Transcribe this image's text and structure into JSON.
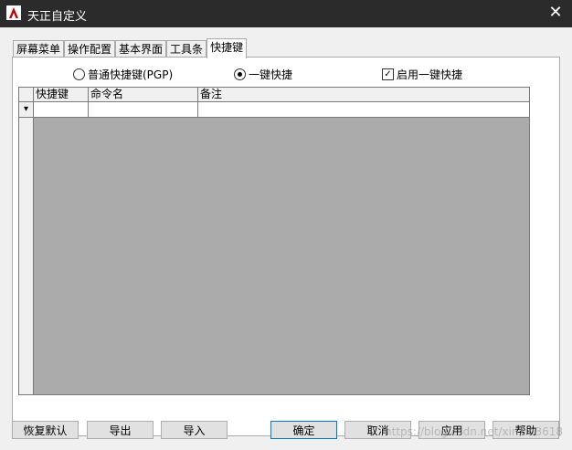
{
  "window": {
    "title": "天正自定义",
    "close_glyph": "✕"
  },
  "tabs": [
    {
      "label": "屏幕菜单"
    },
    {
      "label": "操作配置"
    },
    {
      "label": "基本界面"
    },
    {
      "label": "工具条"
    },
    {
      "label": "快捷键",
      "active": true
    }
  ],
  "options": {
    "normal_shortcut": {
      "label": "普通快捷键(PGP)",
      "selected": false
    },
    "one_key": {
      "label": "一键快捷",
      "selected": true
    },
    "enable_one_key": {
      "label": "启用一键快捷",
      "checked": true
    }
  },
  "grid": {
    "columns": [
      "快捷键",
      "命令名",
      "备注"
    ],
    "new_row_marker": "▾"
  },
  "buttons": {
    "restore_default": "恢复默认",
    "export": "导出",
    "import": "导入",
    "ok": "确定",
    "cancel": "取消",
    "apply": "应用",
    "help": "帮助"
  },
  "watermark": "https://blog.csdn.net/xinxin3618",
  "colors": {
    "titlebar": "#2b2b2b",
    "accent": "#0078d7",
    "grid_bg": "#ababab"
  },
  "icons": {
    "app": "tangent-app-icon",
    "close": "close-icon",
    "dropdown": "dropdown-arrow-icon"
  }
}
